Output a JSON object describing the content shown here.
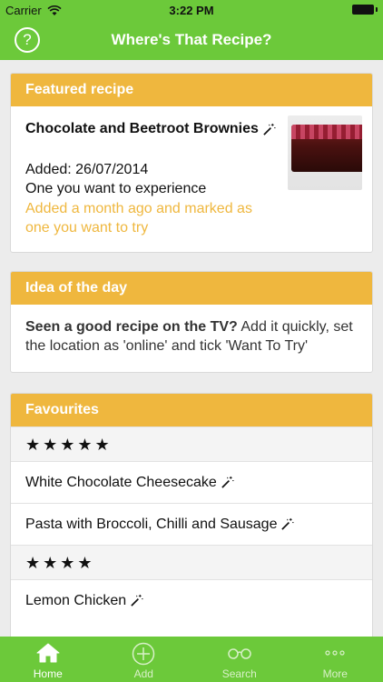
{
  "status": {
    "carrier": "Carrier",
    "time": "3:22 PM"
  },
  "nav": {
    "help_symbol": "?",
    "title": "Where's That Recipe?"
  },
  "featured": {
    "header": "Featured recipe",
    "title": "Chocolate and Beetroot Brownies",
    "added": "Added: 26/07/2014",
    "want": "One you want to experience",
    "note": "Added a month ago and marked as one you want to try"
  },
  "idea": {
    "header": "Idea of the day",
    "bold": "Seen a good recipe on the TV?",
    "rest": " Add it quickly, set the location as 'online' and tick 'Want To Try'"
  },
  "favourites": {
    "header": "Favourites",
    "groups": [
      {
        "stars": "★★★★★",
        "items": [
          "White Chocolate Cheesecake",
          "Pasta with Broccoli, Chilli and Sausage"
        ]
      },
      {
        "stars": "★★★★",
        "items": [
          "Lemon Chicken"
        ]
      }
    ]
  },
  "tabs": [
    {
      "label": "Home",
      "icon": "home-icon"
    },
    {
      "label": "Add",
      "icon": "add-icon"
    },
    {
      "label": "Search",
      "icon": "glasses-icon"
    },
    {
      "label": "More",
      "icon": "more-icon"
    }
  ],
  "colors": {
    "green": "#6cc93a",
    "orange": "#efb73e"
  }
}
